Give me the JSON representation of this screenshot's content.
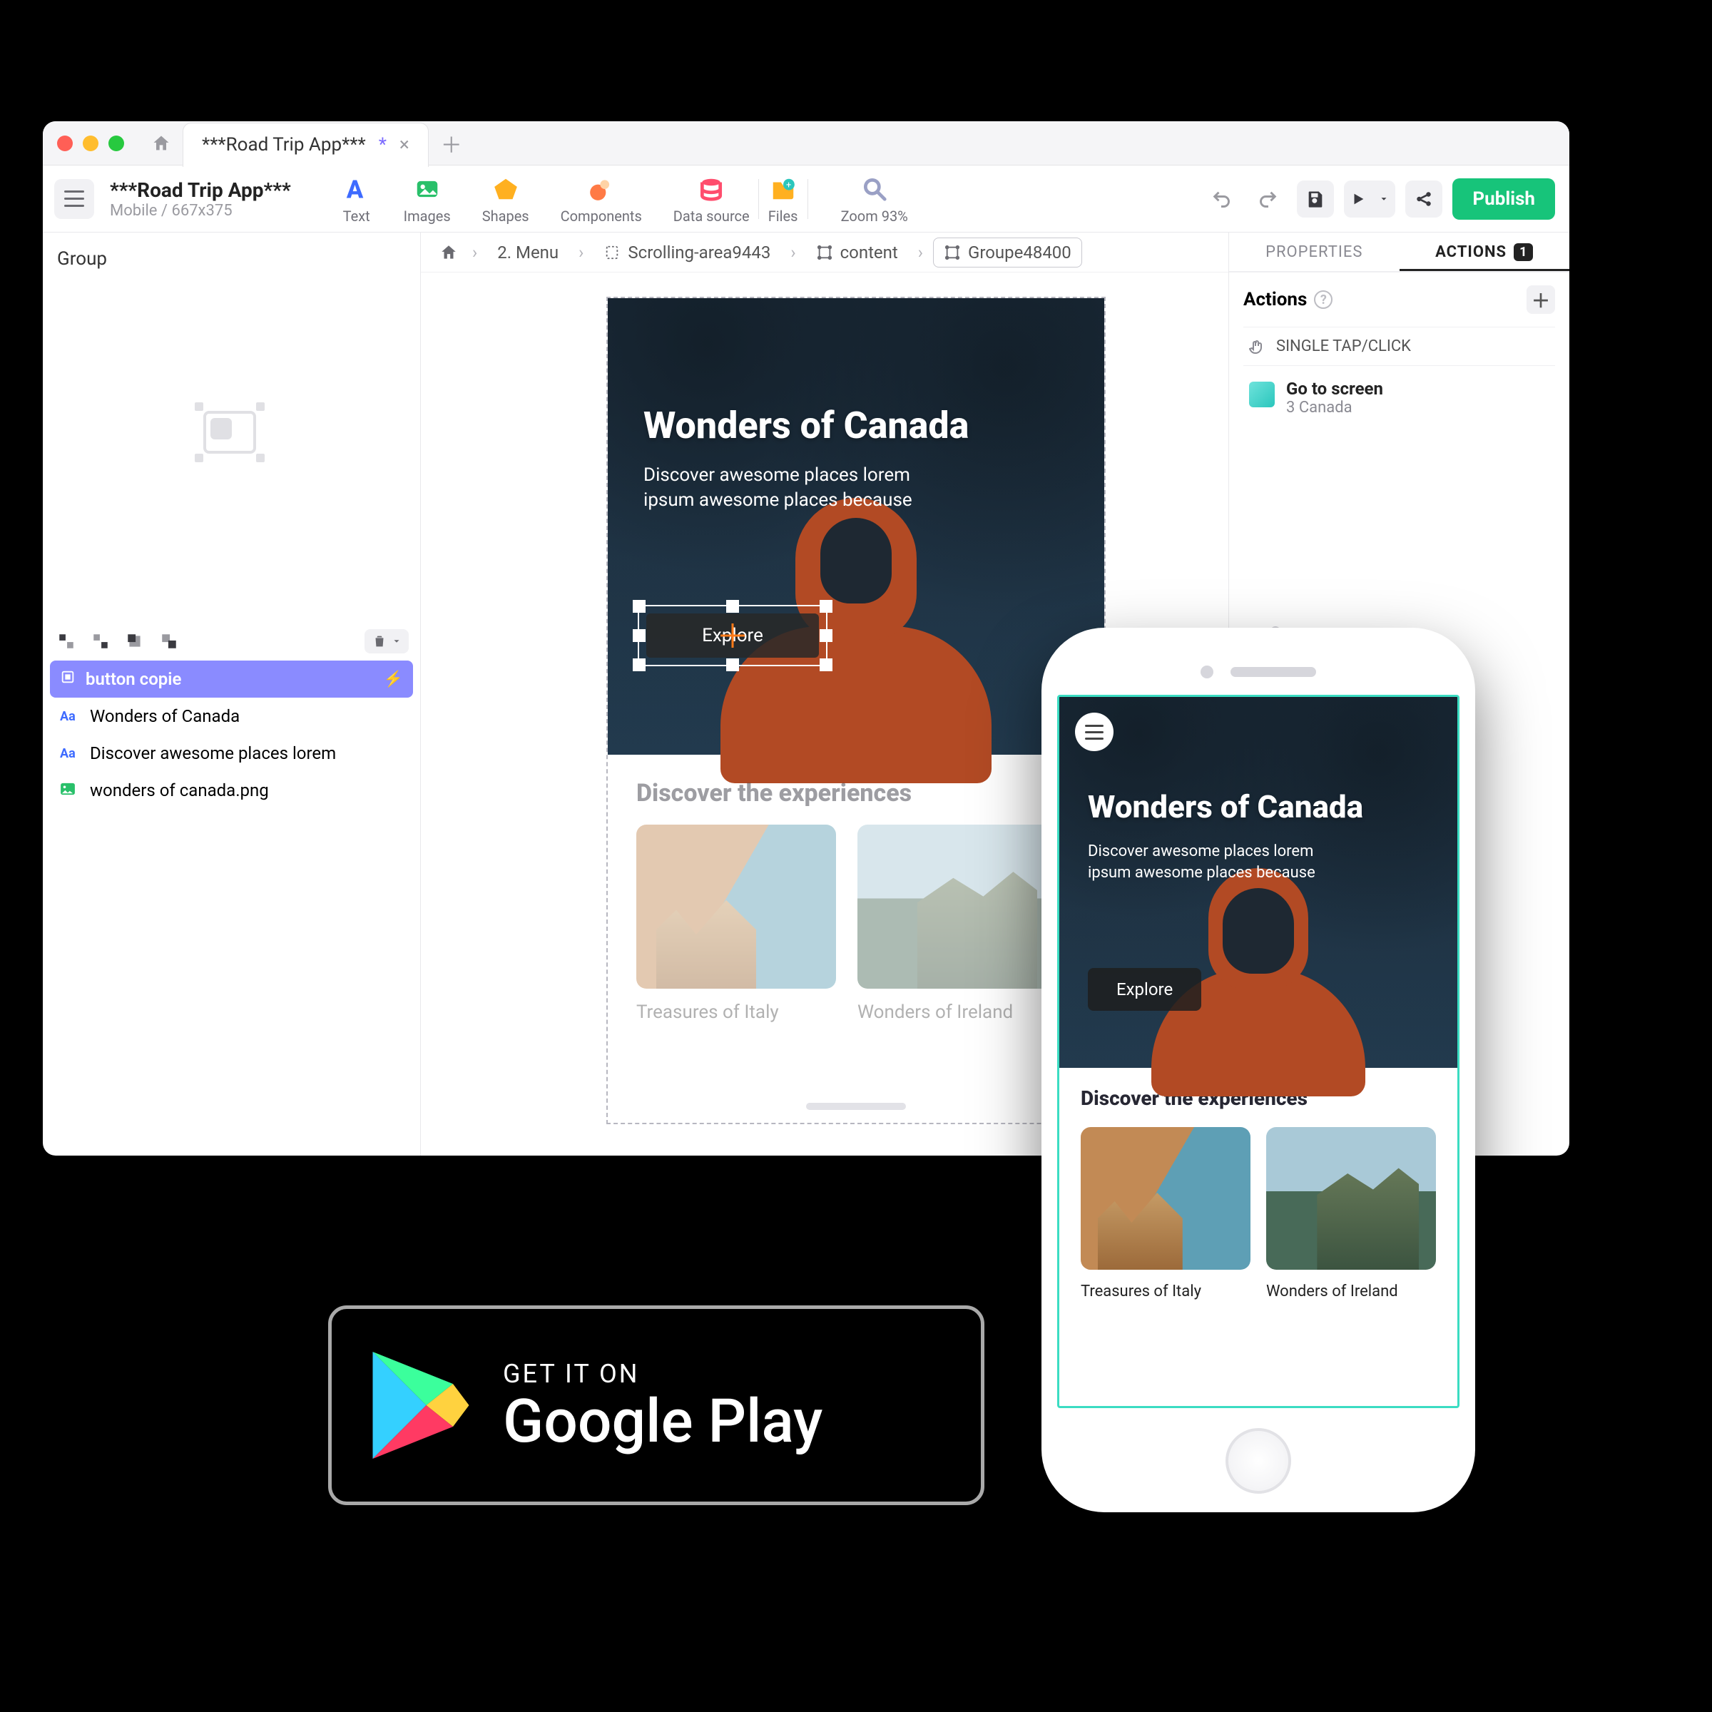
{
  "window": {
    "tab_title": "***Road Trip App***",
    "tab_dirty_marker": "*"
  },
  "project": {
    "title": "***Road Trip App***",
    "subtitle": "Mobile / 667x375"
  },
  "tools": {
    "text": "Text",
    "images": "Images",
    "shapes": "Shapes",
    "components": "Components",
    "datasource": "Data source",
    "files": "Files",
    "zoom": "Zoom 93%"
  },
  "header_buttons": {
    "publish": "Publish"
  },
  "left_pane": {
    "title": "Group"
  },
  "layers": [
    {
      "icon": "group",
      "label": "button copie",
      "selected": true,
      "bolt": true
    },
    {
      "icon": "Aa",
      "label": "Wonders of Canada"
    },
    {
      "icon": "Aa",
      "label": "Discover awesome places lorem"
    },
    {
      "icon": "img",
      "label": "wonders of canada.png"
    }
  ],
  "breadcrumb": [
    {
      "label": "2. Menu"
    },
    {
      "label": "Scrolling-area9443"
    },
    {
      "label": "content"
    },
    {
      "label": "Groupe48400",
      "current": true
    }
  ],
  "canvas": {
    "hero_title": "Wonders of Canada",
    "hero_desc": "Discover awesome places lorem ipsum awesome places because",
    "explore": "Explore",
    "discover_title": "Discover the experiences",
    "cards": [
      {
        "label": "Treasures of Italy"
      },
      {
        "label": "Wonders of Ireland"
      }
    ]
  },
  "right_pane": {
    "tab_properties": "PROPERTIES",
    "tab_actions": "ACTIONS",
    "actions_badge": "1",
    "section_title": "Actions",
    "trigger_label": "SINGLE TAP/CLICK",
    "action_title": "Go to screen",
    "action_subtitle": "3  Canada"
  },
  "phone": {
    "hero_title": "Wonders of Canada",
    "hero_desc": "Discover awesome places lorem ipsum awesome places because",
    "explore": "Explore",
    "discover_title": "Discover the experiences",
    "cards": [
      {
        "label": "Treasures of Italy"
      },
      {
        "label": "Wonders of Ireland"
      }
    ]
  },
  "gplay": {
    "top": "GET IT ON",
    "bottom": "Google Play"
  }
}
